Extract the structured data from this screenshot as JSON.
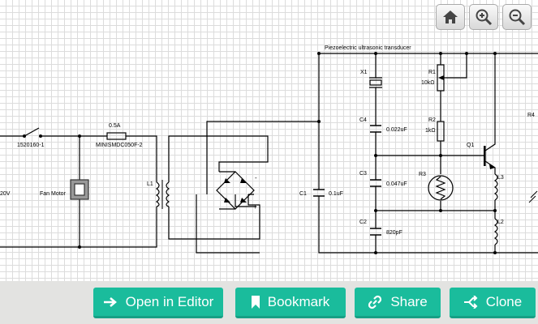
{
  "zoom_controls": {
    "home": "home-icon",
    "zoom_in": "zoom-in-icon",
    "zoom_out": "zoom-out-icon"
  },
  "schematic": {
    "title": "Piezoelectric ultrasonic transducer",
    "labels": {
      "switch": "1520160-1",
      "fuse_rating": "0.5A",
      "fuse_part": "MINISMDC050F-2",
      "mains": "20V",
      "fan_motor": "Fan Motor",
      "l1": "L1",
      "c1": "C1",
      "c1_value": "0.1uF",
      "x1": "X1",
      "c4": "C4",
      "c4_value": "0.022uF",
      "c3": "C3",
      "c3_value": "0.047uF",
      "c2": "C2",
      "c2_value": "820pF",
      "r1": "R1",
      "r1_value": "10kΩ",
      "r2": "R2",
      "r2_value": "1kΩ",
      "r3": "R3",
      "q1": "Q1",
      "l3": "L3",
      "l2": "L2",
      "r4": "R4",
      "minus": "-",
      "plus": "+"
    }
  },
  "toolbar": {
    "open_in_editor": "Open in Editor",
    "bookmark": "Bookmark",
    "share": "Share",
    "clone": "Clone"
  },
  "colors": {
    "accent": "#1abc9c",
    "accent_dark": "#16a085",
    "toolbar_bg": "#e3e3e1"
  }
}
